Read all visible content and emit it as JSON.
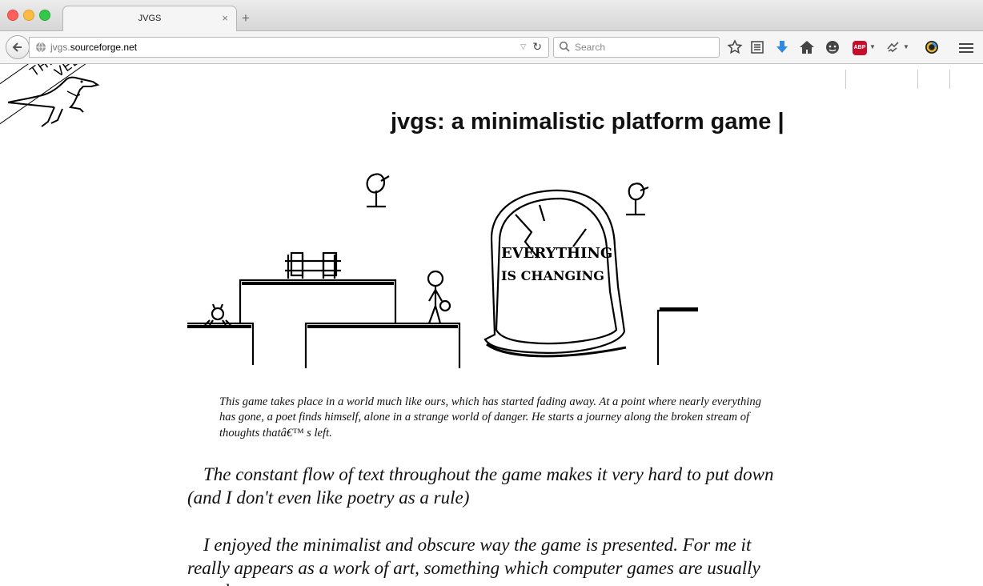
{
  "browser": {
    "tab_title": "JVGS",
    "tab_close": "×",
    "new_tab": "+",
    "url_subdomain": "jvgs.",
    "url_domain": "sourceforge.net",
    "search_placeholder": "Search",
    "toolbar_icons": [
      "bookmark-star-icon",
      "reading-list-icon",
      "download-icon",
      "home-icon",
      "chat-icon",
      "adblock-icon",
      "extension-icon",
      "color-icon",
      "menu-icon"
    ],
    "abp_label": "ABP"
  },
  "page": {
    "banner_line1": "THIS GAME CONTAINS",
    "banner_line2": "VELOCIRAPTORS",
    "headline": "jvgs: a minimalistic platform game |",
    "tombstone_line1": "EVERYTHING",
    "tombstone_line2": "IS CHANGING",
    "caption": "This game takes place in a world much like ours, which has started fading away. At a point where nearly everything has gone, a poet finds himself, alone in a strange world of danger. He starts a journey along the broken stream of thoughts thatâ€™ s left.",
    "quote1": "The constant flow of text throughout the game makes it very hard to put down (and I don't even like poetry as a rule)",
    "quote2": "I enjoyed the minimalist and obscure way the game is presented. For me it really appears as a work of art, something which computer games are usually not about."
  }
}
